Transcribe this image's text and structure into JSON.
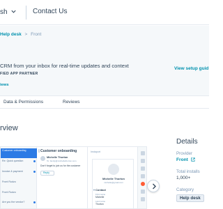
{
  "nav": {
    "partial_item": "sh",
    "contact_us": "Contact Us"
  },
  "breadcrumb": {
    "parent": "Help desk",
    "separator": ">",
    "current": "Front"
  },
  "header": {
    "tagline": "CRM from your inbox for real-time updates and context",
    "partner_badge": "FIED APP PARTNER",
    "reviews_link": "iews",
    "setup_guide": "View setup guid"
  },
  "tabs": [
    {
      "label": "Data & Permissions"
    },
    {
      "label": "Reviews"
    }
  ],
  "overview": {
    "title": "rview"
  },
  "preview": {
    "list_items": [
      {
        "text": "Customer onboarding",
        "active": true
      },
      {
        "text": "Re: Quick question",
        "active": false
      },
      {
        "text": "Invoice & payment",
        "active": false
      },
      {
        "text": "Front Rudzo",
        "active": false
      },
      {
        "text": "Front Rudzo",
        "active": false
      },
      {
        "text": "Are you the vendor?",
        "active": false
      }
    ],
    "thread_title": "Customer onboarding",
    "from_name": "Michelle Thorton",
    "to_line": "To: family@michellethorton.com",
    "message": "Don't forget to join us for the customer",
    "reply_label": "Reply",
    "panel_label": "Instaport",
    "contact_name": "Michelle Thorton",
    "contact_email": "michelle@gmail.com",
    "contact_section": "Contact",
    "fields": [
      {
        "label": "First name",
        "value": "Michelle"
      },
      {
        "label": "Last name",
        "value": "Thorton"
      }
    ]
  },
  "details": {
    "title": "Details",
    "provider_label": "Provider",
    "provider_value": "Front",
    "installs_label": "Total installs",
    "installs_value": "1,000+",
    "category_label": "Category",
    "category_value": "Help desk"
  },
  "colors": {
    "accent": "#0091ae",
    "text": "#33475b",
    "muted": "#7c98b6",
    "header_bg": "#f5f8fa",
    "brand_orange": "#ff5c35"
  },
  "icons": [
    "chevron-down-icon",
    "external-link-icon",
    "chevron-right-icon"
  ]
}
